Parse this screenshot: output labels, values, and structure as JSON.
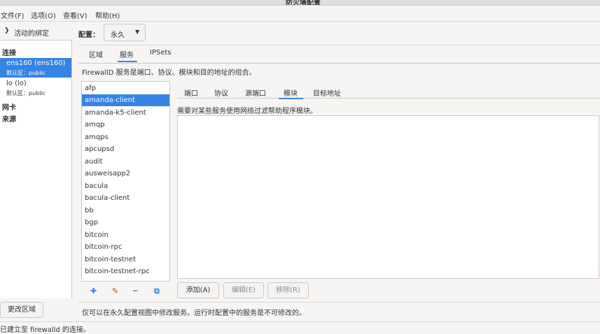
{
  "window": {
    "title": "防火墙配置"
  },
  "menu": [
    "文件(F)",
    "选项(O)",
    "查看(V)",
    "帮助(H)"
  ],
  "sidebar": {
    "header": "活动的绑定",
    "connections_label": "连接",
    "connections": [
      {
        "name": "ens160 (ens160)",
        "zone": "默认区：public",
        "selected": true
      },
      {
        "name": "lo (lo)",
        "zone": "默认区：public",
        "selected": false
      }
    ],
    "interfaces_label": "网卡",
    "sources_label": "来源",
    "change_zone": "更改区域"
  },
  "config": {
    "label": "配置：",
    "value": "永久"
  },
  "tabs": [
    "区域",
    "服务",
    "IPSets"
  ],
  "active_tab": "服务",
  "services_description": "FirewallD 服务是端口、协议、模块和目的地址的组合。",
  "services": [
    "afp",
    "amanda-client",
    "amanda-k5-client",
    "amqp",
    "amqps",
    "apcupsd",
    "audit",
    "ausweisapp2",
    "bacula",
    "bacula-client",
    "bb",
    "bgp",
    "bitcoin",
    "bitcoin-rpc",
    "bitcoin-testnet",
    "bitcoin-testnet-rpc"
  ],
  "selected_service": "amanda-client",
  "subtabs": [
    "端口",
    "协议",
    "源端口",
    "模块",
    "目标地址"
  ],
  "active_subtab": "模块",
  "module_hint": "需要对某些服务使用网络过滤帮助程序模块。",
  "buttons": {
    "add": "添加(A)",
    "edit": "编辑(E)",
    "remove": "移除(R)"
  },
  "note": "仅可以在永久配置视图中修改服务。运行时配置中的服务是不可修改的。",
  "status": "已建立至 firewalld 的连接。",
  "colors": {
    "accent": "#3584e4"
  }
}
